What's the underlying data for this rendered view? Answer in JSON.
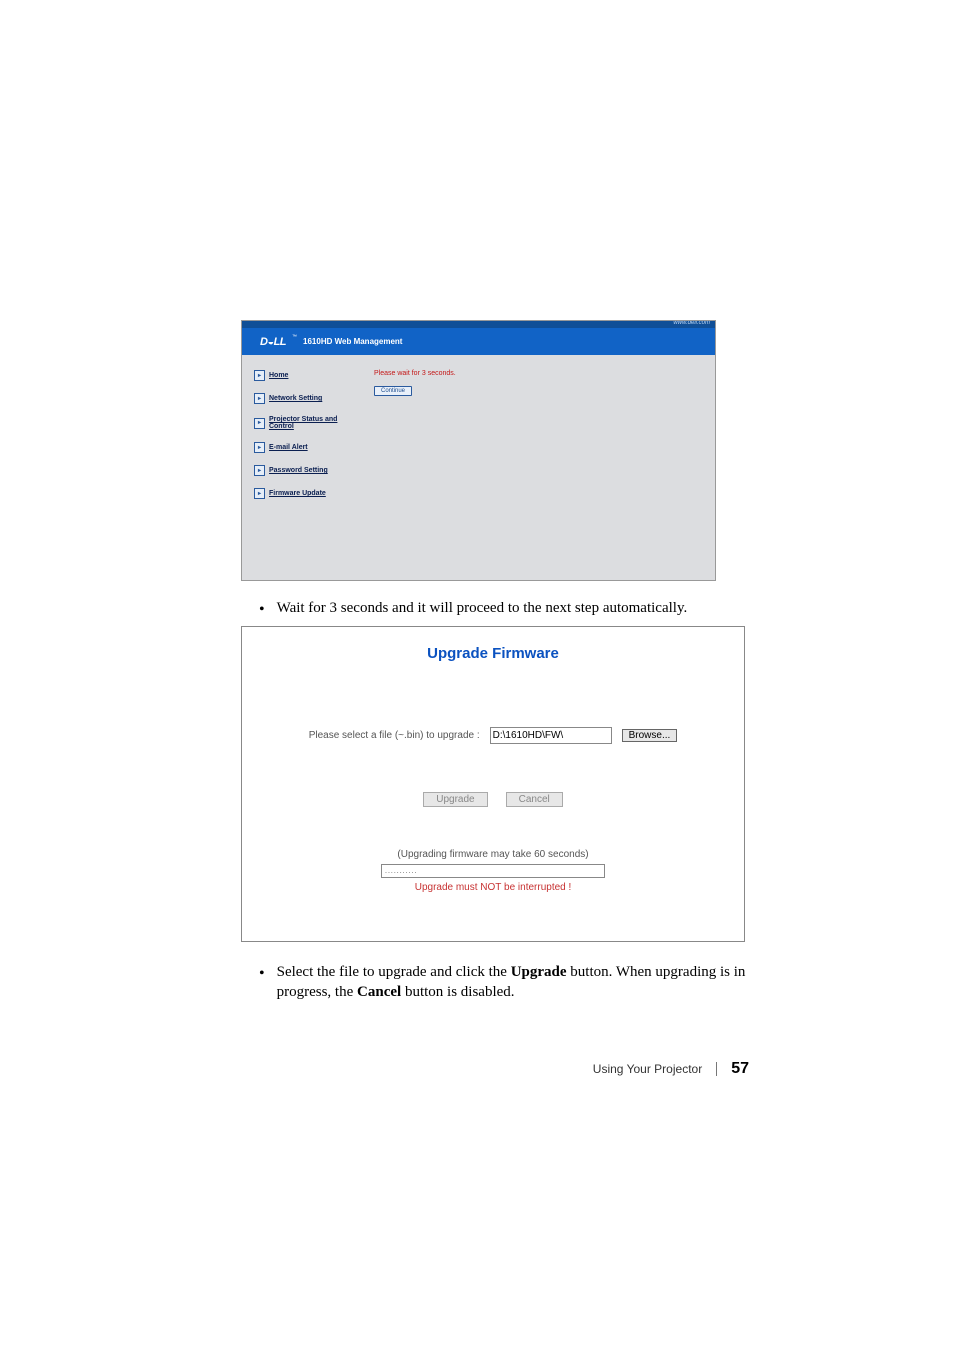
{
  "shot1": {
    "top_url": "www.dell.com",
    "logo": "D◒LL",
    "title": "1610HD Web Management",
    "sidebar": {
      "items": [
        {
          "label": "Home"
        },
        {
          "label": "Network Setting"
        },
        {
          "label": "Projector Status and Control"
        },
        {
          "label": "E-mail Alert"
        },
        {
          "label": "Password Setting"
        },
        {
          "label": "Firmware Update"
        }
      ]
    },
    "wait_msg": "Please wait for 3 seconds.",
    "continue_btn": "Continue"
  },
  "bullet1": "Wait for 3 seconds and it will proceed to the next step automatically.",
  "shot2": {
    "title": "Upgrade Firmware",
    "select_label": "Please select a file (~.bin) to upgrade :",
    "file_value": "D:\\1610HD\\FW\\",
    "browse": "Browse...",
    "upgrade": "Upgrade",
    "cancel": "Cancel",
    "note1": "(Upgrading firmware may take 60 seconds)",
    "prog": "...........",
    "note2": "Upgrade must NOT be interrupted !"
  },
  "bullet2_a": "Select the file to upgrade and click the ",
  "bullet2_bold1": "Upgrade",
  "bullet2_b": " button. When upgrading is in progress, the ",
  "bullet2_bold2": "Cancel",
  "bullet2_c": " button is disabled.",
  "footer": {
    "section": "Using Your Projector",
    "page": "57"
  }
}
